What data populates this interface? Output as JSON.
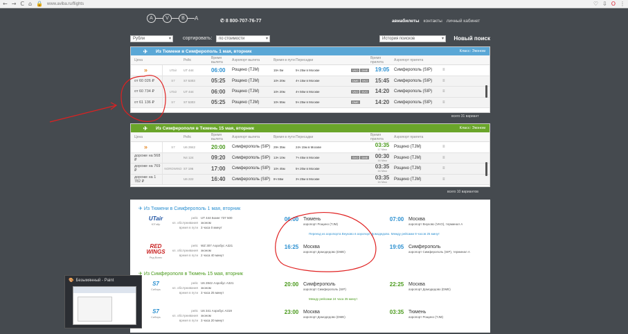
{
  "browser": {
    "url": "www.aviba.ru/flights",
    "back": "←",
    "forward": "→",
    "reload": "C",
    "home": "⌂"
  },
  "header": {
    "logo_letters": [
      "A",
      "V",
      "B",
      "A"
    ],
    "phone": "8 800-707-76-77",
    "nav": [
      "авиабилеты",
      "контакты",
      "личный кабинет"
    ]
  },
  "filters": {
    "currency": "Рубли",
    "sort_label": "сортировать:",
    "sort_value": "по стоимости",
    "history": "История поисков",
    "new_search": "Новый поиск"
  },
  "outbound": {
    "title": "Из Тюмени в Симферополь 1 мая, вторник",
    "class": "Класс: Эконом",
    "columns": [
      "Цена",
      "Рейс",
      "Время вылета",
      "Аэропорт вылета",
      "Время в пути",
      "Пересадки",
      "Время прилета",
      "Аэропорт прилета"
    ],
    "rows": [
      {
        "price": "»",
        "airline": "UTair",
        "flight": "UT 444",
        "dep": "06:00",
        "apt": "Рощино (TJM)",
        "dur": "15ч 0м",
        "tr": "5ч 25м в Москве",
        "b": [
          "VKO",
          "DME"
        ],
        "arr": "19:05",
        "arr_small": "",
        "aapt": "Симферополь (SIP)"
      },
      {
        "price": "от 60 026 ₽",
        "airline": "S7",
        "flight": "S7 5303",
        "dep": "05:25",
        "apt": "Рощино (TJM)",
        "dur": "10ч 20м",
        "tr": "4ч 15м в Москве",
        "b": [
          "DME",
          "VKO"
        ],
        "arr": "15:45",
        "arr_small": "",
        "aapt": "Симферополь (SIP)"
      },
      {
        "price": "от 60 734 ₽",
        "airline": "UTair",
        "flight": "UT 444",
        "dep": "06:00",
        "apt": "Рощино (TJM)",
        "dur": "10ч 20м",
        "tr": "4ч 50м в Москве",
        "b": [
          "VKO",
          "SVO"
        ],
        "arr": "14:20",
        "arr_small": "",
        "aapt": "Симферополь (SIP)"
      },
      {
        "price": "от 61 136 ₽",
        "airline": "S7",
        "flight": "S7 5303",
        "dep": "05:25",
        "apt": "Рощино (TJM)",
        "dur": "10ч 55м",
        "tr": "5ч 25м в Москве",
        "b": [
          "DME"
        ],
        "arr": "14:20",
        "arr_small": "",
        "aapt": "Симферополь (SIP)"
      }
    ],
    "total": "всего 31 вариант"
  },
  "return": {
    "title": "Из Симферополя в Тюмень 15 мая, вторник",
    "class": "Класс: Эконом",
    "columns": [
      "Цена",
      "Рейс",
      "Время вылета",
      "Аэропорт вылета",
      "Время в пути",
      "Пересадки",
      "Время прилета",
      "Аэропорт прилета"
    ],
    "rows": [
      {
        "price": "»",
        "airline": "S7",
        "flight": "U6 2842",
        "dep": "20:00",
        "apt": "Симферополь (SIP)",
        "dur": "29ч 35м",
        "tr": "24ч 15м в Москве",
        "b": [],
        "arr": "03:35",
        "arr_small": "17 Мая",
        "aapt": "Рощино (TJM)"
      },
      {
        "price": "дороже на 568 ₽",
        "airline": "",
        "flight": "N4 124",
        "dep": "09:20",
        "apt": "Симферополь (SIP)",
        "dur": "13ч 10м",
        "tr": "7ч 45м в Москве",
        "b": [
          "SVO",
          "DME"
        ],
        "arr": "00:30",
        "arr_small": "16 Мая",
        "aapt": "Рощино (TJM)"
      },
      {
        "price": "дороже на 769 ₽",
        "airline": "NORDWIND",
        "flight": "S7 196",
        "dep": "17:00",
        "apt": "Симферополь (SIP)",
        "dur": "10ч 45м",
        "tr": "5ч 20м в Москве",
        "b": [],
        "arr": "03:35",
        "arr_small": "16 Мая",
        "aapt": "Рощино (TJM)"
      },
      {
        "price": "дороже на 1 782 ₽",
        "airline": "",
        "flight": "U6 222",
        "dep": "16:40",
        "apt": "Симферополь (SIP)",
        "dur": "8ч 55м",
        "tr": "3ч 25м в Москве",
        "b": [],
        "arr": "03:35",
        "arr_small": "16 Мая",
        "aapt": "Рощино (TJM)"
      }
    ],
    "total": "всего 10 вариантов"
  },
  "details": {
    "out_title": "Из Тюмени в Симферополь 1 мая, вторник",
    "ret_title": "Из Симферополя в Тюмень 15 мая, вторник",
    "labels": [
      "рейс",
      "кл. обслуживания",
      "время в пути"
    ],
    "legs": [
      {
        "logo": "UTair",
        "logo_sub": "ЮТэйр",
        "info": [
          "UT 444 Боинг 737 500",
          "эконом",
          "3 часа 0 минут"
        ],
        "dep": "06:00",
        "from": "Тюмень",
        "from_apt": "аэропорт Рощино (TJM)",
        "arr": "07:00",
        "to": "Москва",
        "to_apt": "аэропорт Внуково (VKO), терминал А"
      },
      {
        "logo": "RED WINGS",
        "logo_sub": "Ред Вингс",
        "info": [
          "WZ 307 Аэробус A321",
          "эконом",
          "2 часа 40 минут"
        ],
        "dep": "16:25",
        "from": "Москва",
        "from_apt": "аэропорт Домодедово (DME)",
        "arr": "19:05",
        "to": "Симферополь",
        "to_apt": "аэропорт Симферополь (SIP), терминал А"
      },
      {
        "logo": "S7",
        "logo_sub": "Сибирь",
        "info": [
          "U6 2842 Аэробус A321",
          "эконом",
          "3 часа 25 минут"
        ],
        "dep": "20:00",
        "from": "Симферополь",
        "from_apt": "аэропорт Симферополь (SIP)",
        "arr": "22:25",
        "to": "Москва",
        "to_apt": "аэропорт Домодедово (DME)"
      },
      {
        "logo": "S7",
        "logo_sub": "Сибирь",
        "info": [
          "U6 341 Аэробус A319",
          "эконом",
          "3 часа 20 минут"
        ],
        "dep": "23:00",
        "from": "Москва",
        "from_apt": "аэропорт Домодедово (DME)",
        "arr": "03:35",
        "to": "Тюмень",
        "to_apt": "аэропорт Рощино (TJM)"
      }
    ],
    "transfer": "Переезд из аэропорта Внуково в аэропорт Домодедово. Между рейсами 9 часов 25 минут",
    "transfer2": "Между рейсами 24 часа 35 минут"
  },
  "taskbar": {
    "title": "Безымянный - Paint"
  },
  "colors": {
    "blue": "#5aa7d6",
    "green": "#6aa52a",
    "accent_blue": "#2a8fd0",
    "annotation_red": "#e02020"
  }
}
